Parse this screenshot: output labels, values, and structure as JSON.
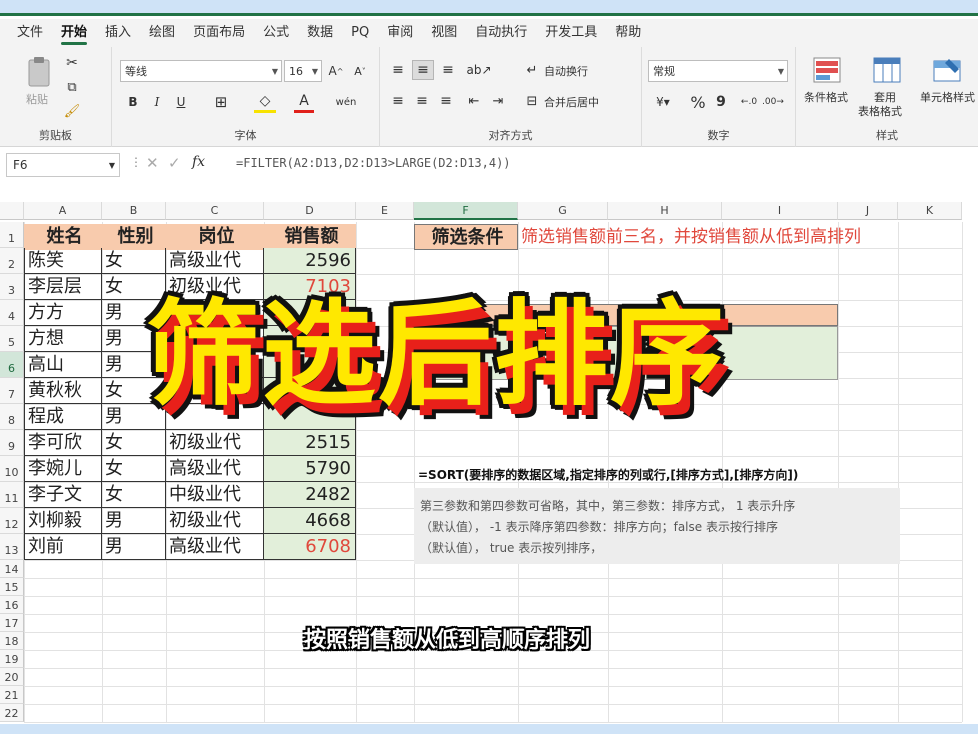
{
  "menu": [
    "文件",
    "开始",
    "插入",
    "绘图",
    "页面布局",
    "公式",
    "数据",
    "PQ",
    "审阅",
    "视图",
    "自动执行",
    "开发工具",
    "帮助"
  ],
  "ribbon": {
    "clipboard": {
      "paste": "粘贴",
      "label": "剪贴板"
    },
    "font": {
      "name": "等线",
      "size": "16",
      "label": "字体",
      "bold": "B",
      "italic": "I",
      "underline": "U",
      "grow": "A^",
      "shrink": "A˅"
    },
    "alignment": {
      "wrap": "自动换行",
      "merge": "合并后居中",
      "label": "对齐方式"
    },
    "number": {
      "format": "常规",
      "percent": "%",
      "comma": "9",
      "label": "数字"
    },
    "styles": {
      "conditional": "条件格式",
      "table_format_1": "套用",
      "table_format_2": "表格格式",
      "cell_styles": "单元格样式",
      "label": "样式"
    }
  },
  "formula_bar": {
    "name_box": "F6",
    "fx": "fx",
    "formula": "=FILTER(A2:D13,D2:D13>LARGE(D2:D13,4))"
  },
  "columns": [
    "A",
    "B",
    "C",
    "D",
    "E",
    "F",
    "G",
    "H",
    "I",
    "J",
    "K"
  ],
  "rows": [
    "1",
    "2",
    "3",
    "4",
    "5",
    "6",
    "7",
    "8",
    "9",
    "10",
    "11",
    "12",
    "13",
    "14",
    "15",
    "16",
    "17",
    "18",
    "19",
    "20",
    "21",
    "22"
  ],
  "table": {
    "headers": [
      "姓名",
      "性别",
      "岗位",
      "销售额"
    ],
    "rows": [
      {
        "name": "陈笑",
        "gender": "女",
        "role": "高级业代",
        "sales": "2596"
      },
      {
        "name": "李层层",
        "gender": "女",
        "role": "初级业代",
        "sales": "7103"
      },
      {
        "name": "方方",
        "gender": "男",
        "role": "",
        "sales": ""
      },
      {
        "name": "方想",
        "gender": "男",
        "role": "",
        "sales": ""
      },
      {
        "name": "高山",
        "gender": "男",
        "role": "",
        "sales": ""
      },
      {
        "name": "黄秋秋",
        "gender": "女",
        "role": "",
        "sales": ""
      },
      {
        "name": "程成",
        "gender": "男",
        "role": "",
        "sales": ""
      },
      {
        "name": "李可欣",
        "gender": "女",
        "role": "初级业代",
        "sales": "2515"
      },
      {
        "name": "李婉儿",
        "gender": "女",
        "role": "高级业代",
        "sales": "5790"
      },
      {
        "name": "李子文",
        "gender": "女",
        "role": "中级业代",
        "sales": "2482"
      },
      {
        "name": "刘柳毅",
        "gender": "男",
        "role": "初级业代",
        "sales": "4668"
      },
      {
        "name": "刘前",
        "gender": "男",
        "role": "高级业代",
        "sales": "6708"
      }
    ]
  },
  "filter_label": "筛选条件",
  "filter_desc": "筛选销售额前三名，并按销售额从低到高排列",
  "sort_syntax": "=SORT(要排序的数据区域,指定排序的列或行,[排序方式],[排序方向])",
  "sort_note_lines": [
    "第三参数和第四参数可省略，其中，第三参数：排序方式， 1 表示升序",
    "（默认值）， -1 表示降序第四参数：排序方向；false 表示按行排序",
    "（默认值）， true 表示按列排序，"
  ],
  "overlay_title": "筛选后排序",
  "subtitle": "按照销售额从低到高顺序排列",
  "colors": {
    "accent": "#217346",
    "header_fill": "#f8cbad",
    "sales_fill": "#e2efda",
    "red": "#e0483c"
  }
}
